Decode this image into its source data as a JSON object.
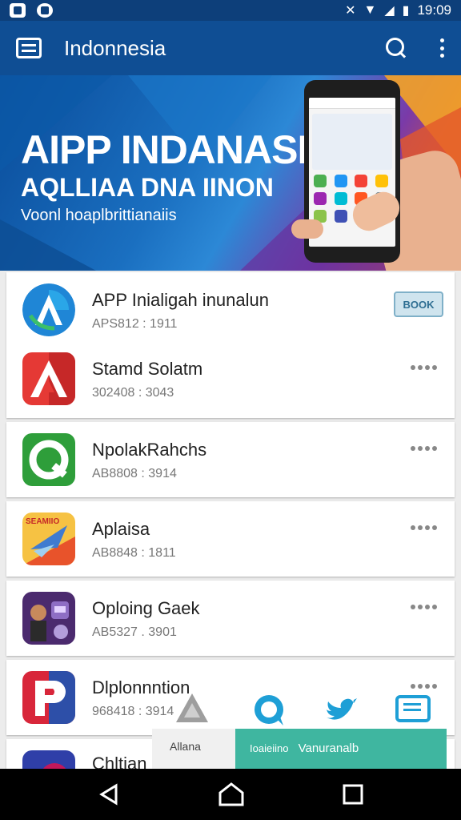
{
  "status_bar": {
    "time": "19:09",
    "icons": [
      "photo-icon",
      "shield-icon",
      "mute-icon",
      "wifi-icon",
      "signal-icon",
      "battery-icon"
    ]
  },
  "app_bar": {
    "title": "Indonnesia",
    "icons": [
      "menu-icon",
      "search-icon",
      "more-vert-icon"
    ]
  },
  "banner": {
    "title": "AIPP INDANASIA",
    "subtitle": "AQLLIAA DNA IINON",
    "tagline": "Voonl hoaplbrittianaiis"
  },
  "apps": [
    {
      "name": "APP Inialigah inunalun",
      "code": "APS812 : 1911",
      "action": "BOOK",
      "icon": "a-logo-icon"
    },
    {
      "name": "Stamd Solatm",
      "code": "302408 : 3043",
      "action": "more",
      "icon": "red-a-icon"
    },
    {
      "name": "NpolakRahchs",
      "code": "AB8808 : 3914",
      "action": "more",
      "icon": "green-q-icon"
    },
    {
      "name": "Aplaisa",
      "code": "AB8848 : 1811",
      "action": "more",
      "icon": "bird-icon",
      "icon_text": "SEAMIIO"
    },
    {
      "name": "Oploing Gaek",
      "code": "AB5327 . 3901",
      "action": "more",
      "icon": "game-character-icon"
    },
    {
      "name": "Dlplonnntion",
      "code": "968418 : 3914",
      "action": "more",
      "icon": "p-logo-icon"
    },
    {
      "name": "Chltian",
      "code": "",
      "action": "",
      "icon": "purple-app-icon"
    }
  ],
  "share_overlay": {
    "icons": [
      "warning-triangle-icon",
      "chat-bubble-icon",
      "twitter-icon",
      "message-icon"
    ],
    "tab_left": "Allana",
    "tab_right_prefix": "Ioaieiino",
    "tab_right_label": "Vanuranalb"
  },
  "nav_bar": {
    "icons": [
      "back-icon",
      "home-icon",
      "recent-apps-icon"
    ]
  }
}
